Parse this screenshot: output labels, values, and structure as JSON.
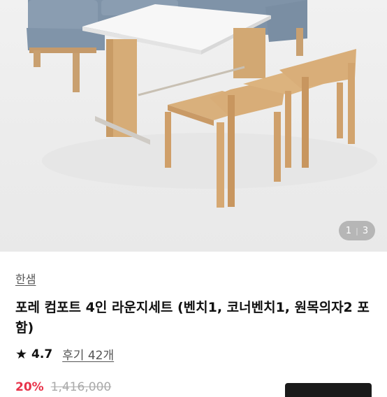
{
  "hero": {
    "pager": {
      "current": "1",
      "separator": "|",
      "total": "3"
    }
  },
  "product": {
    "brand": "한샘",
    "title": "포레 컴포트 4인 라운지세트 (벤치1, 코너벤치1, 원목의자2 포함)",
    "rating": "4.7",
    "reviews_label": "후기 42개",
    "discount": "20%",
    "original_price": "1,416,000"
  },
  "icons": {
    "star": "star-icon"
  }
}
